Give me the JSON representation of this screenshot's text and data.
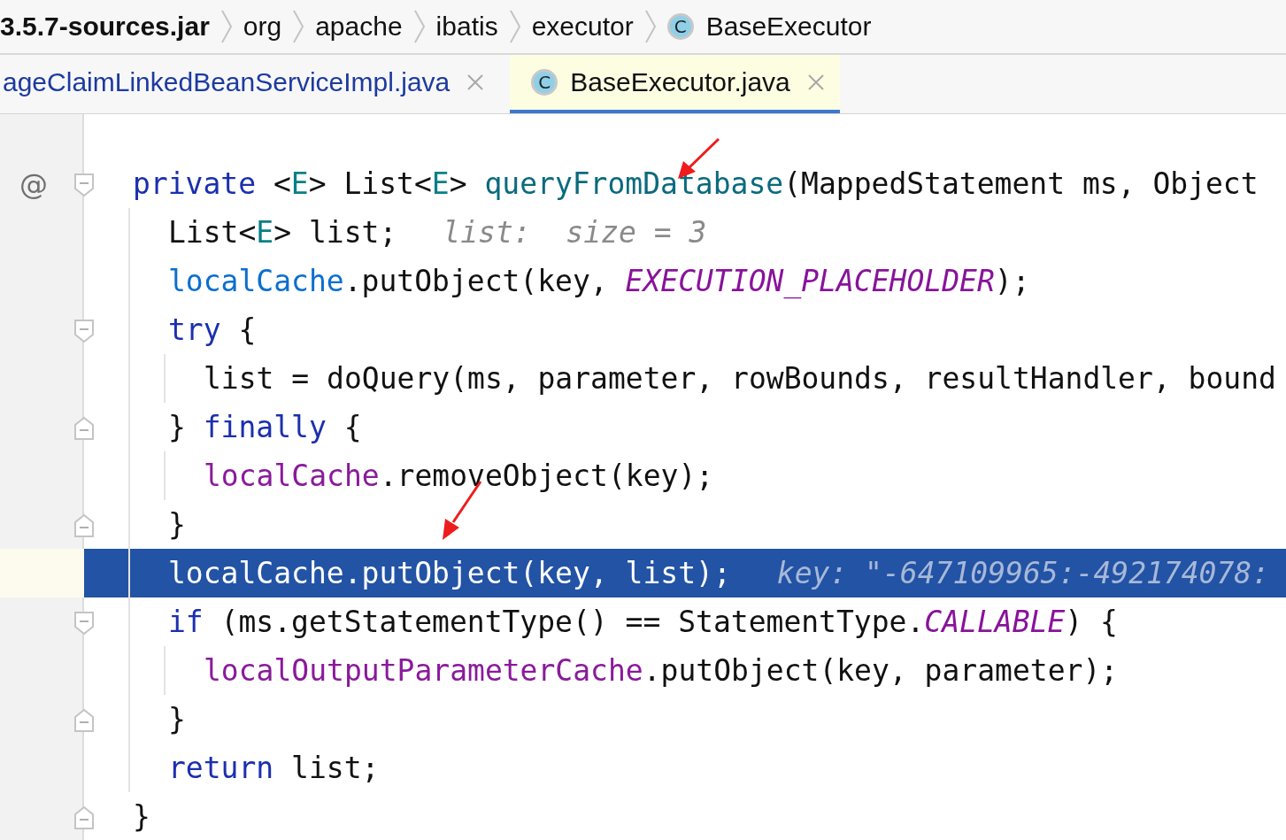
{
  "breadcrumb": [
    {
      "label": "3.5.7-sources.jar",
      "kind": "jar"
    },
    {
      "label": "org",
      "kind": "package"
    },
    {
      "label": "apache",
      "kind": "package"
    },
    {
      "label": "ibatis",
      "kind": "package"
    },
    {
      "label": "executor",
      "kind": "package"
    },
    {
      "label": "BaseExecutor",
      "kind": "class",
      "icon": "C"
    }
  ],
  "tabs": [
    {
      "label": "ageClaimLinkedBeanServiceImpl.java",
      "selected": false
    },
    {
      "label": "BaseExecutor.java",
      "selected": true,
      "icon": "C"
    }
  ],
  "editor": {
    "lines": [
      {
        "gutter_mark": "@",
        "kind": "opener",
        "selected": false,
        "tokens": [
          {
            "text": "private",
            "kind": "keyword"
          },
          {
            "text": " <",
            "kind": "plain"
          },
          {
            "text": "E",
            "kind": "type"
          },
          {
            "text": "> List<",
            "kind": "plain"
          },
          {
            "text": "E",
            "kind": "type"
          },
          {
            "text": "> ",
            "kind": "plain"
          },
          {
            "text": "queryFromDatabase",
            "kind": "method"
          },
          {
            "text": "(MappedStatement ms, Object",
            "kind": "plain"
          }
        ],
        "children": [
          {
            "selected": false,
            "tokens": [
              {
                "text": "List<",
                "kind": "plain"
              },
              {
                "text": "E",
                "kind": "type"
              },
              {
                "text": "> list;",
                "kind": "plain"
              }
            ],
            "hint": "list:  size = 3"
          },
          {
            "selected": false,
            "tokens": [
              {
                "text": "localCache",
                "kind": "field"
              },
              {
                "text": ".putObject(key, ",
                "kind": "plain"
              },
              {
                "text": "EXECUTION_PLACEHOLDER",
                "kind": "constant"
              },
              {
                "text": ");",
                "kind": "plain"
              }
            ]
          },
          {
            "selected": false,
            "kind": "opener",
            "tokens": [
              {
                "text": "try",
                "kind": "keyword"
              },
              {
                "text": " {",
                "kind": "plain"
              }
            ],
            "children": [
              {
                "selected": false,
                "tokens": [
                  {
                    "text": "list = doQuery(ms, parameter, rowBounds, resultHandler, bound",
                    "kind": "plain"
                  }
                ]
              }
            ]
          },
          {
            "selected": false,
            "kind": "closer",
            "tokens": [
              {
                "text": "} ",
                "kind": "plain"
              },
              {
                "text": "finally",
                "kind": "keyword"
              },
              {
                "text": " {",
                "kind": "plain"
              }
            ],
            "children": [
              {
                "selected": false,
                "tokens": [
                  {
                    "text": "localCache",
                    "kind": "member"
                  },
                  {
                    "text": ".removeObject(key);",
                    "kind": "plain"
                  }
                ]
              }
            ]
          },
          {
            "selected": false,
            "kind": "closer",
            "tokens": [
              {
                "text": "}",
                "kind": "plain"
              }
            ]
          },
          {
            "selected": true,
            "tokens": [
              {
                "text": "localCache",
                "kind": "field"
              },
              {
                "text": ".putObject(key, list);",
                "kind": "plain"
              }
            ],
            "hint": "key: \"-647109965:-492174078:"
          },
          {
            "selected": false,
            "kind": "opener",
            "tokens": [
              {
                "text": "if",
                "kind": "keyword"
              },
              {
                "text": " (ms.getStatementType() == StatementType.",
                "kind": "plain"
              },
              {
                "text": "CALLABLE",
                "kind": "constant"
              },
              {
                "text": ") {",
                "kind": "plain"
              }
            ],
            "children": [
              {
                "selected": false,
                "tokens": [
                  {
                    "text": "localOutputParameterCache",
                    "kind": "member"
                  },
                  {
                    "text": ".putObject(key, parameter);",
                    "kind": "plain"
                  }
                ]
              }
            ]
          },
          {
            "selected": false,
            "kind": "closer",
            "tokens": [
              {
                "text": "}",
                "kind": "plain"
              }
            ]
          },
          {
            "selected": false,
            "tokens": [
              {
                "text": "return",
                "kind": "keyword"
              },
              {
                "text": " list;",
                "kind": "plain"
              }
            ]
          }
        ]
      },
      {
        "selected": false,
        "kind": "closer",
        "tokens": [
          {
            "text": "}",
            "kind": "plain"
          }
        ]
      }
    ]
  }
}
